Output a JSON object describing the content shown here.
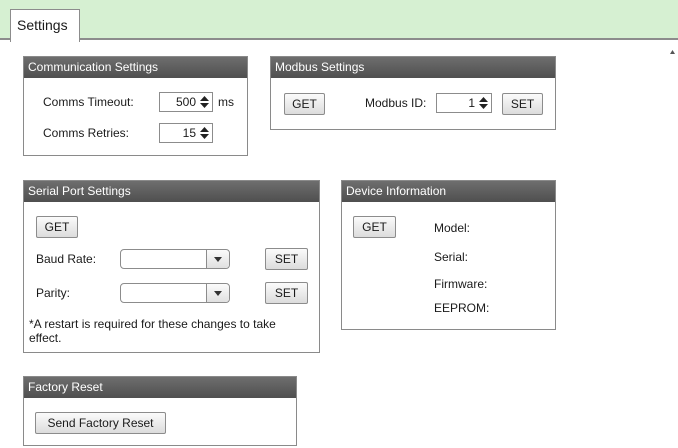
{
  "tab": {
    "label": "Settings"
  },
  "communication": {
    "title": "Communication Settings",
    "timeout_label": "Comms Timeout:",
    "timeout_value": "500",
    "timeout_unit": "ms",
    "retries_label": "Comms Retries:",
    "retries_value": "15"
  },
  "modbus": {
    "title": "Modbus Settings",
    "get_label": "GET",
    "id_label": "Modbus ID:",
    "id_value": "1",
    "set_label": "SET"
  },
  "serial": {
    "title": "Serial Port Settings",
    "get_label": "GET",
    "baud_label": "Baud Rate:",
    "baud_value": "",
    "baud_set_label": "SET",
    "parity_label": "Parity:",
    "parity_value": "",
    "parity_set_label": "SET",
    "note": "*A restart is required for these changes to take effect."
  },
  "device": {
    "title": "Device Information",
    "get_label": "GET",
    "model_label": "Model:",
    "serial_label": "Serial:",
    "firmware_label": "Firmware:",
    "eeprom_label": "EEPROM:"
  },
  "factory": {
    "title": "Factory Reset",
    "button_label": "Send Factory Reset"
  },
  "icons": {
    "spin": "spin-updown-icon",
    "dropdown": "chevron-down-icon",
    "scroll": "scroll-up-arrow-icon"
  }
}
